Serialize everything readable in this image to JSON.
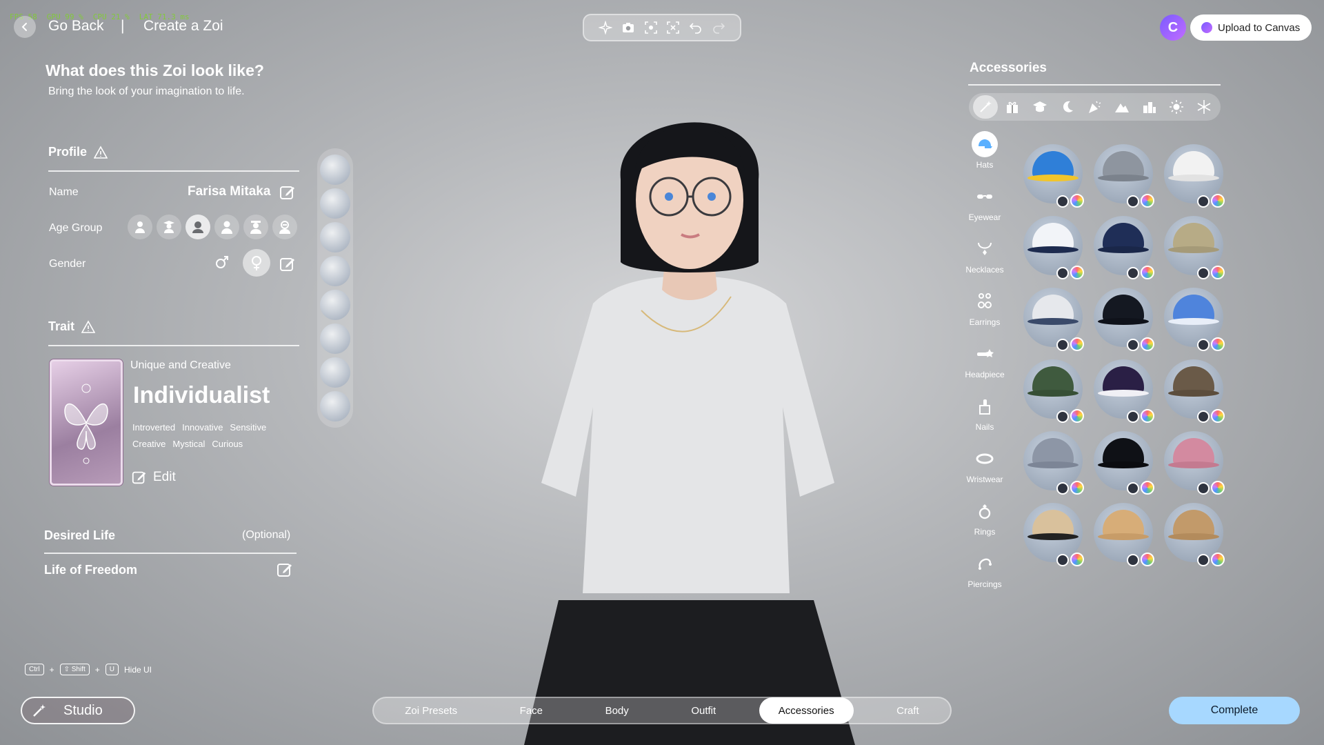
{
  "header": {
    "go_back": "Go Back",
    "separator": "|",
    "current": "Create a Zoi",
    "perf_overlay": [
      "FPS 58",
      "GPU 99 %",
      "CPU 21 %",
      "LAT 71.3 ms"
    ]
  },
  "toolbar": {
    "icons": [
      "sparkle-icon",
      "camera-icon",
      "frame-capture-icon",
      "focus-icon",
      "undo-icon",
      "redo-icon"
    ]
  },
  "canvas": {
    "logo_letter": "C",
    "upload_label": "Upload to Canvas"
  },
  "intro": {
    "title": "What does this Zoi look like?",
    "subtitle": "Bring the look of your imagination to life."
  },
  "profile": {
    "title": "Profile",
    "name_label": "Name",
    "name_value": "Farisa Mitaka",
    "age_label": "Age Group",
    "age_options": [
      "child",
      "young",
      "teen",
      "adult",
      "middle-aged",
      "elder"
    ],
    "age_selected_index": 2,
    "gender_label": "Gender",
    "gender_selected": "female"
  },
  "trait": {
    "title": "Trait",
    "kicker": "Unique and Creative",
    "name": "Individualist",
    "tags": [
      "Introverted",
      "Innovative",
      "Sensitive",
      "Creative",
      "Mystical",
      "Curious"
    ],
    "edit_label": "Edit"
  },
  "desired_life": {
    "title": "Desired Life",
    "optional": "(Optional)",
    "value": "Life of Freedom"
  },
  "shortcut": {
    "keys": [
      "Ctrl",
      "⇧ Shift",
      "U"
    ],
    "plus": "+",
    "label": "Hide UI"
  },
  "studio": {
    "label": "Studio"
  },
  "accessories": {
    "title": "Accessories",
    "filters": [
      "all-icon",
      "gift-icon",
      "graduation-cap-icon",
      "moon-icon",
      "party-icon",
      "mountain-icon",
      "city-icon",
      "sun-icon",
      "snowflake-icon"
    ],
    "filter_selected_index": 0,
    "categories": [
      {
        "label": "Hats",
        "icon": "cap-icon"
      },
      {
        "label": "Eyewear",
        "icon": "glasses-icon"
      },
      {
        "label": "Necklaces",
        "icon": "necklace-icon"
      },
      {
        "label": "Earrings",
        "icon": "earrings-icon"
      },
      {
        "label": "Headpiece",
        "icon": "headpiece-icon"
      },
      {
        "label": "Nails",
        "icon": "nails-icon"
      },
      {
        "label": "Wristwear",
        "icon": "bracelet-icon"
      },
      {
        "label": "Rings",
        "icon": "ring-icon"
      },
      {
        "label": "Piercings",
        "icon": "piercing-icon"
      }
    ],
    "category_selected_index": 0,
    "items": [
      {
        "color": "#2f7fd8",
        "brim": "#f2c52a"
      },
      {
        "color": "#8e959f",
        "brim": "#7b828c"
      },
      {
        "color": "#f2f2f2",
        "brim": "#e2e2e2"
      },
      {
        "color": "#f2f4f8",
        "brim": "#1d2b4f"
      },
      {
        "color": "#1f2e57",
        "brim": "#1a2749"
      },
      {
        "color": "#b7ab86",
        "brim": "#a59a78"
      },
      {
        "color": "#e6e8ec",
        "brim": "#3a4a6a"
      },
      {
        "color": "#141821",
        "brim": "#0f121a"
      },
      {
        "color": "#4f84dc",
        "brim": "#e8eef8"
      },
      {
        "color": "#3f5a3e",
        "brim": "#364f35"
      },
      {
        "color": "#2a1f45",
        "brim": "#f0f0f5"
      },
      {
        "color": "#6a5a48",
        "brim": "#5c4d3c"
      },
      {
        "color": "#8d96a6",
        "brim": "#7c8596"
      },
      {
        "color": "#0f1116",
        "brim": "#0b0c10"
      },
      {
        "color": "#d38aa0",
        "brim": "#c47a90"
      },
      {
        "color": "#d9c19c",
        "brim": "#222222"
      },
      {
        "color": "#d7ad78",
        "brim": "#c79c68"
      },
      {
        "color": "#c29a6a",
        "brim": "#b38b5c"
      }
    ]
  },
  "tabs": {
    "items": [
      "Zoi Presets",
      "Face",
      "Body",
      "Outfit",
      "Accessories",
      "Craft"
    ],
    "active_index": 4
  },
  "complete_label": "Complete",
  "colors": {
    "accent": "#a7d8ff",
    "canvas_purple": "#7a5bff",
    "perf_green": "#7fd12a"
  }
}
